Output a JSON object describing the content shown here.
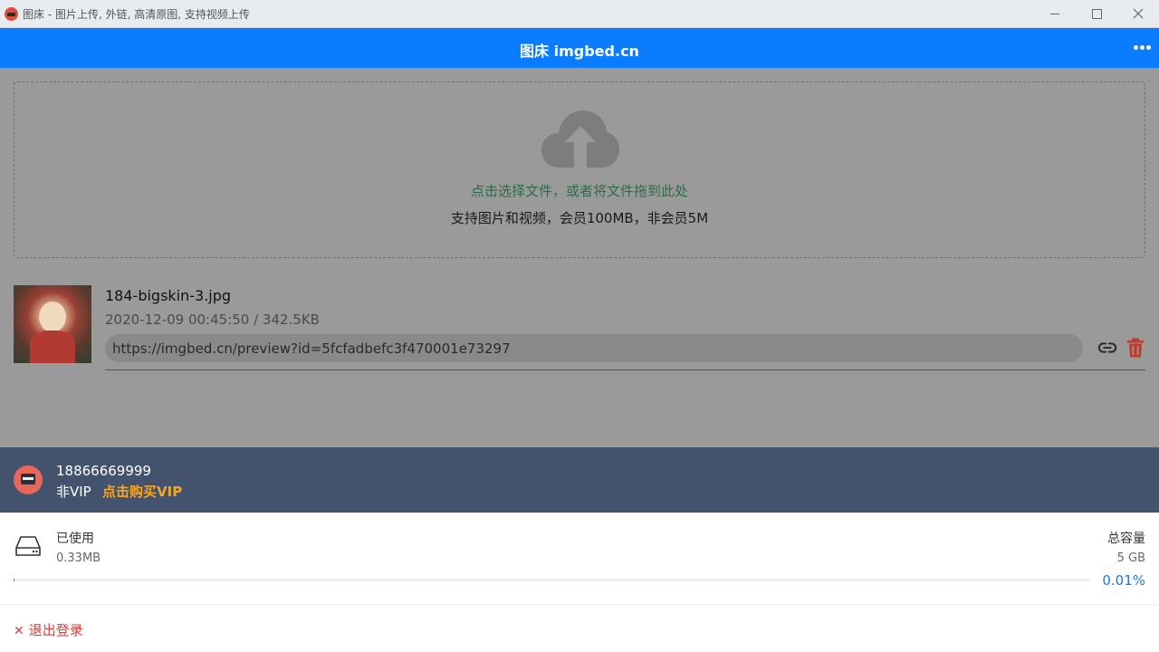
{
  "window": {
    "title": "图床 - 图片上传, 外链, 高清原图, 支持视频上传",
    "controls": [
      "minimize-icon",
      "maximize-icon",
      "close-icon"
    ]
  },
  "header": {
    "title": "图床 imgbed.cn",
    "menu_icon": "more-horizontal-icon",
    "color": "#0a7cff"
  },
  "upload": {
    "icon": "cloud-upload-icon",
    "hint": "点击选择文件，或者将文件拖到此处",
    "limits": "支持图片和视频，会员100MB，非会员5M"
  },
  "files": [
    {
      "name": "184-bigskin-3.jpg",
      "meta": "2020-12-09 00:45:50 / 342.5KB",
      "link": "https://imgbed.cn/preview?id=5fcfadbefc3f470001e73297",
      "actions": [
        "link-icon",
        "trash-icon"
      ]
    }
  ],
  "user": {
    "phone": "18866669999",
    "vip_status": "非VIP",
    "buy_vip": "点击购买VIP",
    "bar_color": "#43536d",
    "accent": "#f5a623"
  },
  "storage": {
    "used_label": "已使用",
    "used_value": "0.33MB",
    "total_label": "总容量",
    "total_value": "5 GB",
    "percent_text": "0.01%",
    "progress_fraction": 0.0001,
    "progress_color": "#1677ff"
  },
  "footer": {
    "logout_icon": "close-icon",
    "logout_label": "退出登录",
    "logout_color": "#d8423d"
  }
}
